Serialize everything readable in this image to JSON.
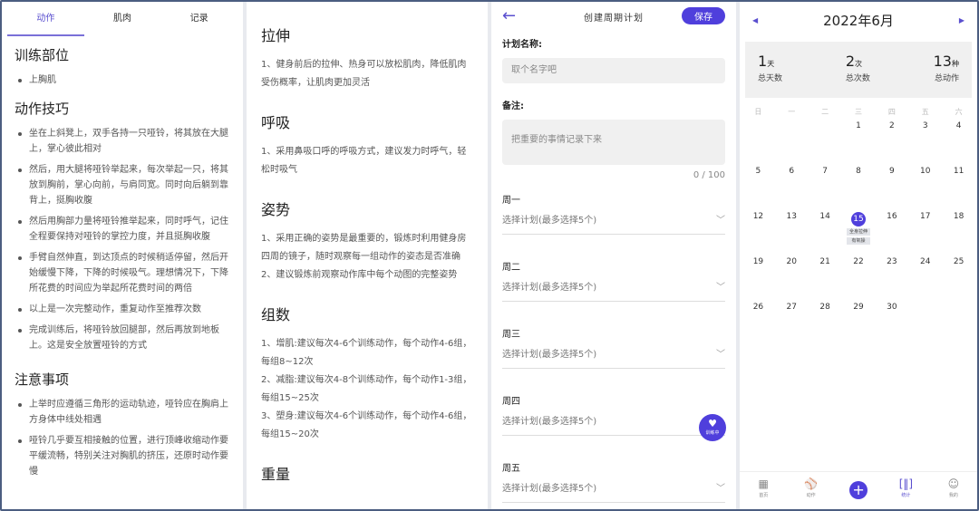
{
  "p1": {
    "tabs": [
      "动作",
      "肌肉",
      "记录"
    ],
    "s1_title": "训练部位",
    "s1_items": [
      "上胸肌"
    ],
    "s2_title": "动作技巧",
    "s2_items": [
      "坐在上斜凳上，双手各持一只哑铃，将其放在大腿上，掌心彼此相对",
      "然后，用大腿将哑铃举起来，每次举起一只，将其放到胸前，掌心向前，与肩同宽。同时向后躺到靠背上，挺胸收腹",
      "然后用胸部力量将哑铃推举起来，同时呼气，记住全程要保持对哑铃的掌控力度，并且挺胸收腹",
      "手臂自然伸直，到达顶点的时候稍适停留，然后开始缓慢下降，下降的时候吸气。理想情况下，下降所花费的时间应为举起所花费时间的两倍",
      "以上是一次完整动作，重复动作至推荐次数",
      "完成训练后，将哑铃放回腿部，然后再放到地板上。这是安全放置哑铃的方式"
    ],
    "s3_title": "注意事项",
    "s3_items": [
      "上举时应遵循三角形的运动轨迹，哑铃应在胸肩上方身体中线处相遇",
      "哑铃几乎要互相接触的位置，进行顶峰收缩动作要平缓流畅，特别关注对胸肌的挤压，还原时动作要慢"
    ]
  },
  "p2": {
    "sections": [
      {
        "title": "拉伸",
        "lines": [
          "1、健身前后的拉伸、热身可以放松肌肉，降低肌肉受伤概率，让肌肉更加灵活"
        ]
      },
      {
        "title": "呼吸",
        "lines": [
          "1、采用鼻吸口呼的呼吸方式，建议发力时呼气，轻松时吸气"
        ]
      },
      {
        "title": "姿势",
        "lines": [
          "1、采用正确的姿势是最重要的，锻炼时利用健身房四周的镜子，随时观察每一组动作的姿态是否准确",
          "2、建议锻炼前观察动作库中每个动图的完整姿势"
        ]
      },
      {
        "title": "组数",
        "lines": [
          "1、增肌:建议每次4-6个训练动作，每个动作4-6组，每组8~12次",
          "2、减脂:建议每次4-8个训练动作，每个动作1-3组，每组15~25次",
          "3、塑身:建议每次4-6个训练动作，每个动作4-6组，每组15~20次"
        ]
      },
      {
        "title": "重量",
        "lines": []
      }
    ]
  },
  "p3": {
    "title": "创建周期计划",
    "save": "保存",
    "name_label": "计划名称:",
    "name_placeholder": "取个名字吧",
    "note_label": "备注:",
    "note_placeholder": "把重要的事情记录下来",
    "counter": "0 / 100",
    "days": [
      "周一",
      "周二",
      "周三",
      "周四",
      "周五"
    ],
    "select_placeholder": "选择计划(最多选择5个)",
    "fab_label": "训练中"
  },
  "p4": {
    "month": "2022年6月",
    "stats": [
      {
        "v": "1",
        "u": "天",
        "k": "总天数"
      },
      {
        "v": "2",
        "u": "次",
        "k": "总次数"
      },
      {
        "v": "13",
        "u": "种",
        "k": "总动作"
      }
    ],
    "weekdays": [
      "日",
      "一",
      "二",
      "三",
      "四",
      "五",
      "六"
    ],
    "today": 15,
    "today_chips": [
      "全身拉伸",
      "有氧操"
    ],
    "nav": [
      "首页",
      "动作",
      "",
      "统计",
      "我的"
    ],
    "accent": "#4f3fdc"
  }
}
